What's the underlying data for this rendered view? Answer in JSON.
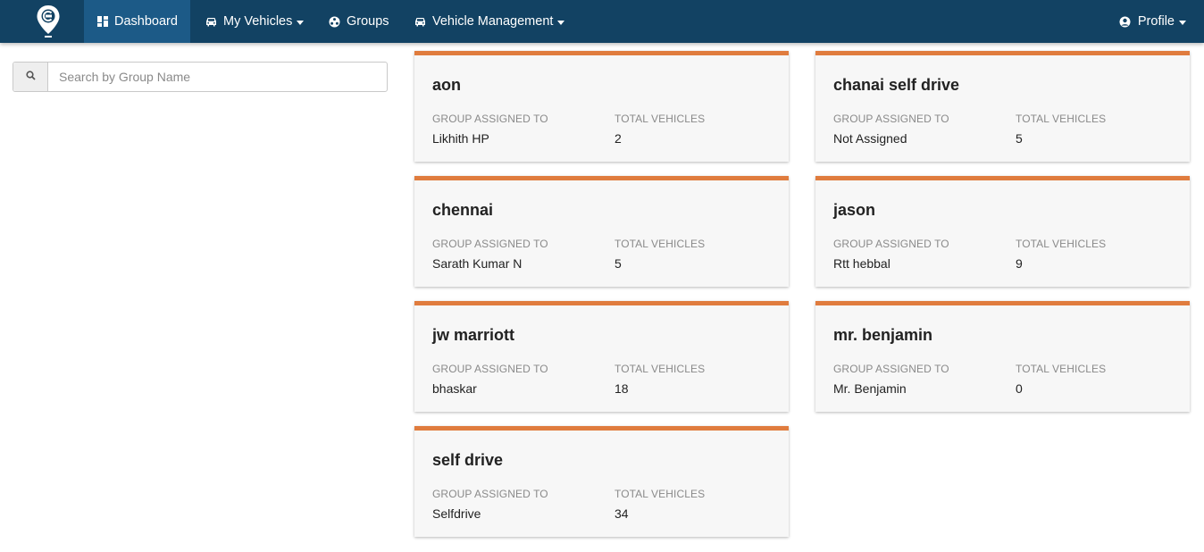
{
  "nav": {
    "dashboard": "Dashboard",
    "my_vehicles": "My Vehicles",
    "groups": "Groups",
    "vehicle_management": "Vehicle Management",
    "profile": "Profile"
  },
  "search": {
    "placeholder": "Search by Group Name",
    "value": ""
  },
  "labels": {
    "assigned": "GROUP ASSIGNED TO",
    "total": "TOTAL VEHICLES"
  },
  "groups": [
    {
      "name": "aon",
      "assigned_to": "Likhith HP",
      "total_vehicles": "2"
    },
    {
      "name": "chanai self drive",
      "assigned_to": "Not Assigned",
      "total_vehicles": "5"
    },
    {
      "name": "chennai",
      "assigned_to": "Sarath Kumar N",
      "total_vehicles": "5"
    },
    {
      "name": "jason",
      "assigned_to": "Rtt hebbal",
      "total_vehicles": "9"
    },
    {
      "name": "jw marriott",
      "assigned_to": "bhaskar",
      "total_vehicles": "18"
    },
    {
      "name": "mr. benjamin",
      "assigned_to": "Mr. Benjamin",
      "total_vehicles": "0"
    },
    {
      "name": "self drive",
      "assigned_to": "Selfdrive",
      "total_vehicles": "34"
    }
  ],
  "colors": {
    "navbar": "#124263",
    "active_nav": "#1c5a87",
    "card_accent": "#e07c3e"
  }
}
